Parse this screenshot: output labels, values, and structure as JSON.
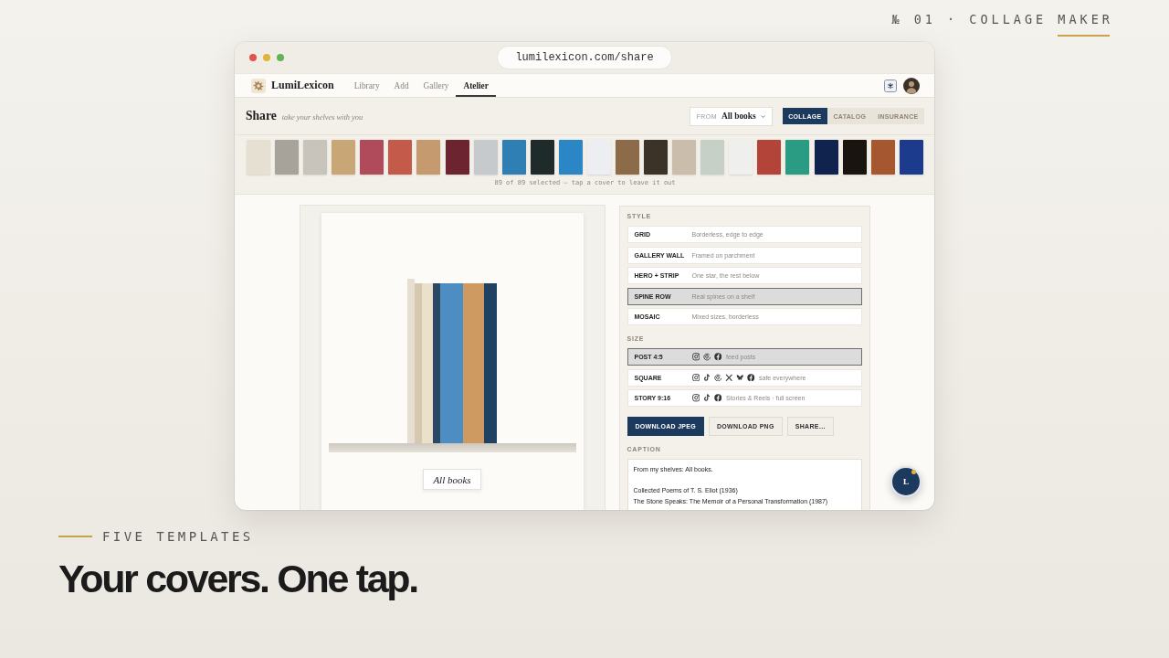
{
  "kicker": "№ 01 · COLLAGE MAKER",
  "browser": {
    "url": "lumilexicon.com/share"
  },
  "app": {
    "brand": "LumiLexicon",
    "nav": [
      {
        "label": "Library",
        "selected": false
      },
      {
        "label": "Add",
        "selected": false
      },
      {
        "label": "Gallery",
        "selected": false
      },
      {
        "label": "Atelier",
        "selected": true
      }
    ],
    "share_bar": {
      "title": "Share",
      "subtitle": "take your shelves with you",
      "source": {
        "prefix": "FROM",
        "value": "All books"
      },
      "modes": [
        {
          "label": "COLLAGE",
          "selected": true
        },
        {
          "label": "CATALOG",
          "selected": false
        },
        {
          "label": "INSURANCE",
          "selected": false
        }
      ]
    },
    "covers": [
      {
        "color": "#e6e0d2"
      },
      {
        "color": "#a8a39a"
      },
      {
        "color": "#c8c4bc"
      },
      {
        "color": "#c9a676"
      },
      {
        "color": "#b04b5c"
      },
      {
        "color": "#c45a4a"
      },
      {
        "color": "#c49a6e"
      },
      {
        "color": "#6c2430"
      },
      {
        "color": "#c6cacd"
      },
      {
        "color": "#2f7fb5"
      },
      {
        "color": "#1f2b2a"
      },
      {
        "color": "#2a86c4"
      },
      {
        "color": "#eceef2"
      },
      {
        "color": "#8b6b48"
      },
      {
        "color": "#3b3328"
      },
      {
        "color": "#cbbdab"
      },
      {
        "color": "#c7d0c7"
      },
      {
        "color": "#efefed"
      },
      {
        "color": "#b3443a"
      },
      {
        "color": "#2a9c84"
      },
      {
        "color": "#10224e"
      },
      {
        "color": "#1a1410"
      },
      {
        "color": "#a5582f"
      },
      {
        "color": "#1d3b8c"
      }
    ],
    "covers_note": "89 of 89 selected — tap a cover to leave it out",
    "preview": {
      "label": "All books"
    },
    "style": {
      "heading": "STYLE",
      "options": [
        {
          "name": "GRID",
          "description": "Borderless, edge to edge",
          "selected": false
        },
        {
          "name": "GALLERY WALL",
          "description": "Framed on parchment",
          "selected": false
        },
        {
          "name": "HERO + STRIP",
          "description": "One star, the rest below",
          "selected": false
        },
        {
          "name": "SPINE ROW",
          "description": "Real spines on a shelf",
          "selected": true
        },
        {
          "name": "MOSAIC",
          "description": "Mixed sizes, borderless",
          "selected": false
        }
      ]
    },
    "size": {
      "heading": "SIZE",
      "options": [
        {
          "name": "POST 4:5",
          "icons": [
            {
              "kind": "instagram"
            },
            {
              "kind": "threads"
            },
            {
              "kind": "facebook"
            }
          ],
          "description": "feed posts",
          "selected": true
        },
        {
          "name": "SQUARE",
          "icons": [
            {
              "kind": "instagram"
            },
            {
              "kind": "tiktok"
            },
            {
              "kind": "threads"
            },
            {
              "kind": "x"
            },
            {
              "kind": "bluesky"
            },
            {
              "kind": "facebook"
            }
          ],
          "description": "safe everywhere",
          "selected": false
        },
        {
          "name": "STORY 9:16",
          "icons": [
            {
              "kind": "instagram"
            },
            {
              "kind": "tiktok"
            },
            {
              "kind": "facebook"
            }
          ],
          "description": "Stories & Reels · full screen",
          "selected": false
        }
      ]
    },
    "actions": [
      {
        "label": "DOWNLOAD JPEG",
        "kind": "primary"
      },
      {
        "label": "DOWNLOAD PNG",
        "kind": "secondary"
      },
      {
        "label": "SHARE…",
        "kind": "secondary"
      }
    ],
    "caption": {
      "heading": "CAPTION",
      "value": "From my shelves: All books.\n\nCollected Poems of T. S. Eliot (1936)\nThe Stone Speaks: The Memoir of a Personal Transformation (1987)"
    },
    "help_button": {
      "label": "L",
      "notification": true
    }
  },
  "footer": {
    "kicker": "FIVE TEMPLATES",
    "headline": "Your covers. One tap."
  }
}
